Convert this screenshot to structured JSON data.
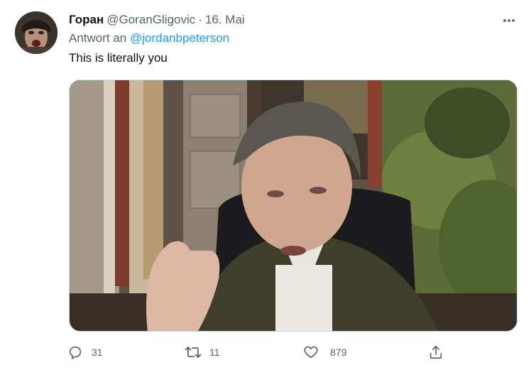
{
  "tweet": {
    "display_name": "Горан",
    "handle": "@GoranGligovic",
    "separator": "·",
    "date": "16. Mai",
    "reply_prefix": "Antwort an",
    "reply_to": "@jordanbpeterson",
    "text": "This is literally you"
  },
  "actions": {
    "reply_count": "31",
    "retweet_count": "11",
    "like_count": "879"
  },
  "icons": {
    "more": "more-icon",
    "reply": "reply-icon",
    "retweet": "retweet-icon",
    "like": "heart-icon",
    "share": "share-icon"
  },
  "colors": {
    "accent": "#1d9bf0",
    "secondary_text": "#536471",
    "primary_text": "#0f1419"
  }
}
